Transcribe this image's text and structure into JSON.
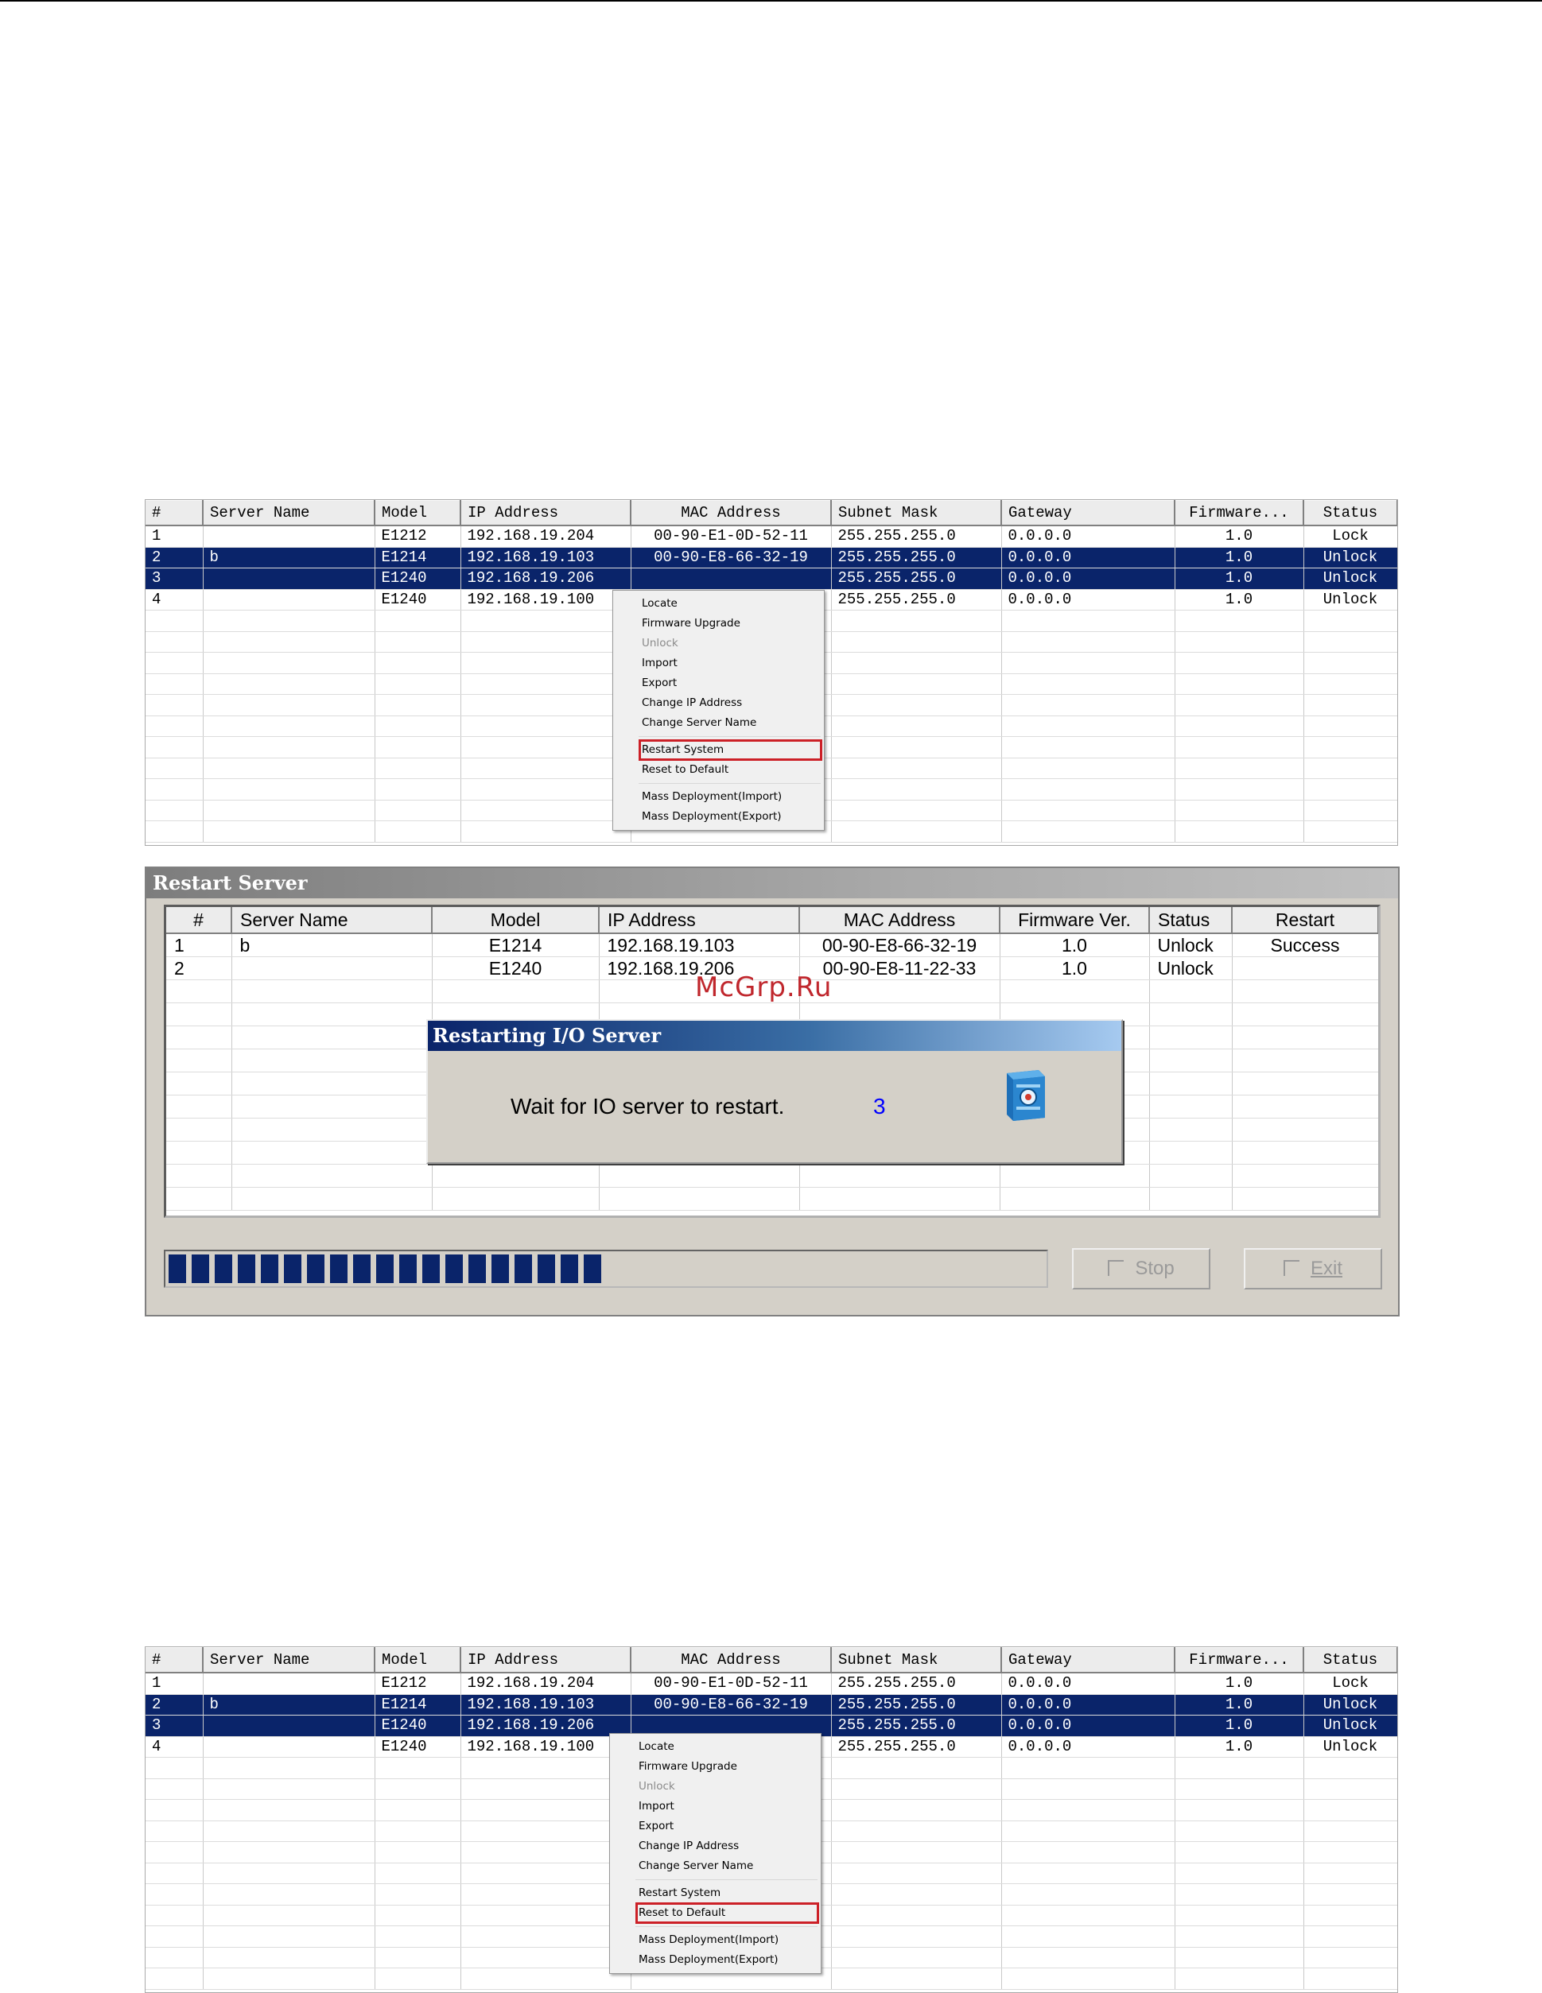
{
  "device_list": {
    "columns": [
      "#",
      "Server Name",
      "Model",
      "IP Address",
      "MAC Address",
      "Subnet Mask",
      "Gateway",
      "Firmware...",
      "Status"
    ],
    "rows": [
      [
        "1",
        "",
        "E1212",
        "192.168.19.204",
        "00-90-E1-0D-52-11",
        "255.255.255.0",
        "0.0.0.0",
        "1.0",
        "Lock"
      ],
      [
        "2",
        "b",
        "E1214",
        "192.168.19.103",
        "00-90-E8-66-32-19",
        "255.255.255.0",
        "0.0.0.0",
        "1.0",
        "Unlock"
      ],
      [
        "3",
        "",
        "E1240",
        "192.168.19.206",
        "",
        "255.255.255.0",
        "0.0.0.0",
        "1.0",
        "Unlock"
      ],
      [
        "4",
        "",
        "E1240",
        "192.168.19.100",
        "",
        "255.255.255.0",
        "0.0.0.0",
        "1.0",
        "Unlock"
      ]
    ],
    "selected_rows": [
      2,
      3
    ]
  },
  "context_menu": {
    "items": [
      "Locate",
      "Firmware Upgrade",
      "Unlock",
      "Import",
      "Export",
      "Change IP Address",
      "Change Server Name",
      "Restart System",
      "Reset to Default",
      "Mass Deployment(Import)",
      "Mass Deployment(Export)"
    ],
    "disabled": [
      "Unlock"
    ]
  },
  "screen1_highlighted_item": "Restart System",
  "screen2_highlighted_item": "Reset to Default",
  "restart_window": {
    "title": "Restart Server",
    "columns": [
      "#",
      "Server Name",
      "Model",
      "IP Address",
      "MAC Address",
      "Firmware Ver.",
      "Status",
      "Restart"
    ],
    "rows": [
      [
        "1",
        "b",
        "E1214",
        "192.168.19.103",
        "00-90-E8-66-32-19",
        "1.0",
        "Unlock",
        "Success"
      ],
      [
        "2",
        "",
        "E1240",
        "192.168.19.206",
        "00-90-E8-11-22-33",
        "1.0",
        "Unlock",
        ""
      ]
    ],
    "progress": 0.5,
    "stop_label": "Stop",
    "exit_label": "Exit"
  },
  "dialog": {
    "title": "Restarting I/O Server",
    "message": "Wait for IO server to restart.",
    "countdown": "3"
  },
  "watermark": "McGrp.Ru",
  "colors": {
    "selection": "#0a246a",
    "highlight_box": "#cc2027",
    "progress_fill": "#0a246a",
    "watermark": "#c0272d"
  },
  "icons": [
    "io-server-icon"
  ]
}
